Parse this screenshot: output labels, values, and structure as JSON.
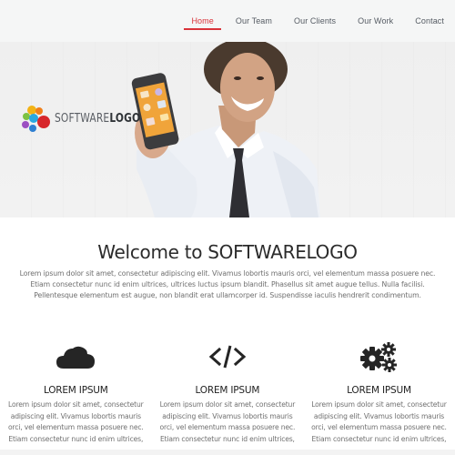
{
  "nav": {
    "items": [
      {
        "label": "Home",
        "active": true
      },
      {
        "label": "Our Team",
        "active": false
      },
      {
        "label": "Our Clients",
        "active": false
      },
      {
        "label": "Our Work",
        "active": false
      },
      {
        "label": "Contact",
        "active": false
      }
    ],
    "accent_color": "#d9333a"
  },
  "hero": {
    "logo_text_light": "SOFTWARE",
    "logo_text_bold": "LOGO",
    "image": "man-holding-smartphone",
    "phone_screen_color": "#f0a43a"
  },
  "welcome": {
    "title_prefix": "Welcome to SOFTWARE",
    "title_bold": "LOGO",
    "body": "Lorem ipsum dolor sit amet, consectetur adipiscing elit. Vivamus lobortis mauris orci, vel elementum massa posuere nec. Etiam consectetur nunc id enim ultrices, ultrices luctus ipsum blandit. Phasellus sit amet augue tellus. Nulla facilisi. Pellentesque elementum est augue, non blandit erat ullamcorper id. Suspendisse iaculis hendrerit condimentum."
  },
  "features": [
    {
      "icon": "cloud-icon",
      "title": "LOREM IPSUM",
      "body": "Lorem ipsum dolor sit amet, consectetur adipiscing elit. Vivamus lobortis mauris orci, vel elementum massa posuere nec. Etiam consectetur nunc id enim ultrices,"
    },
    {
      "icon": "code-icon",
      "title": "LOREM IPSUM",
      "body": "Lorem ipsum dolor sit amet, consectetur adipiscing elit. Vivamus lobortis mauris orci, vel elementum massa posuere nec. Etiam consectetur nunc id enim ultrices,"
    },
    {
      "icon": "gears-icon",
      "title": "LOREM IPSUM",
      "body": "Lorem ipsum dolor sit amet, consectetur adipiscing elit. Vivamus lobortis mauris orci, vel elementum massa posuere nec. Etiam consectetur nunc id enim ultrices,"
    }
  ]
}
